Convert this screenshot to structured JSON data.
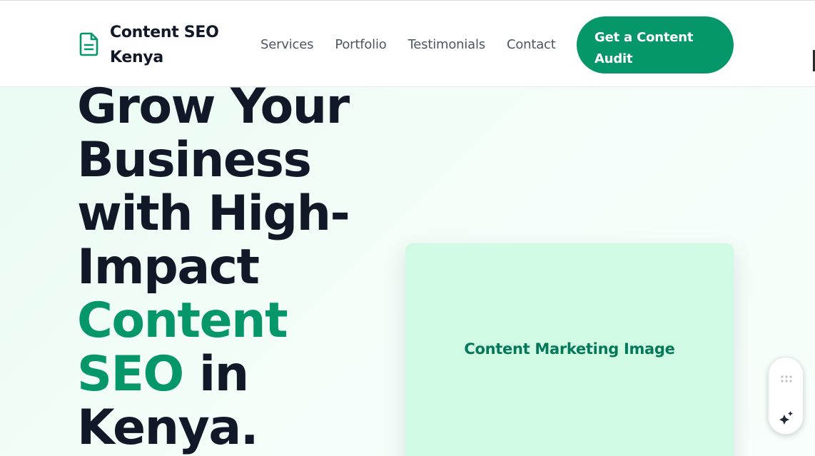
{
  "header": {
    "brand_name": "Content SEO Kenya",
    "brand_icon": "document-icon",
    "nav": [
      "Services",
      "Portfolio",
      "Testimonials",
      "Contact"
    ],
    "cta_label": "Get a Content Audit"
  },
  "hero": {
    "title_part1": "Grow Your Business with High-Impact ",
    "title_accent": "Content SEO",
    "title_part2": " in Kenya.",
    "image_placeholder": "Content Marketing Image"
  },
  "widget": {
    "grip_icon": "drag-handle-icon",
    "action_icon": "sparkle-icon"
  },
  "colors": {
    "accent": "#059669",
    "text_dark": "#111827",
    "nav_text": "#4b5563",
    "image_bg": "#d1fae5",
    "image_text": "#047857"
  }
}
